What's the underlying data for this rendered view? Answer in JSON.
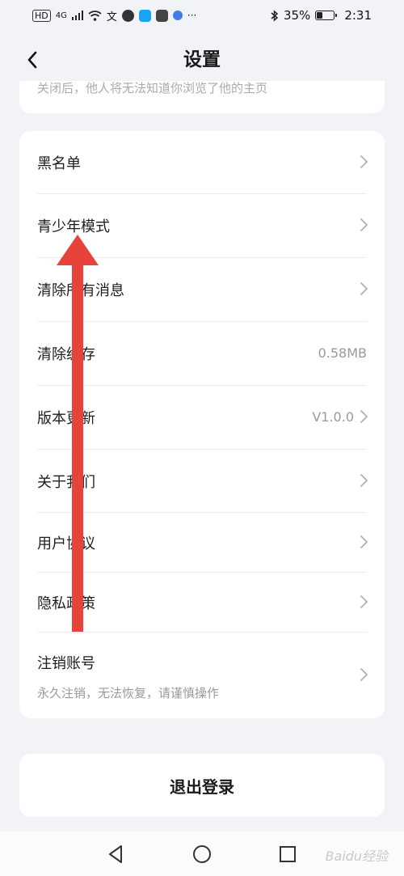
{
  "status_bar": {
    "network_chip": "HD",
    "network_type": "4G",
    "battery_percent": "35%",
    "battery_level": 0.35,
    "time": "2:31",
    "extra": "···"
  },
  "header": {
    "title": "设置"
  },
  "top_card": {
    "hint": "关闭后，他人将无法知道你浏览了他的主页"
  },
  "settings": {
    "items": [
      {
        "label": "黑名单",
        "value": ""
      },
      {
        "label": "青少年模式",
        "value": ""
      },
      {
        "label": "清除所有消息",
        "value": ""
      },
      {
        "label": "清除缓存",
        "value": "0.58MB"
      },
      {
        "label": "版本更新",
        "value": "V1.0.0"
      },
      {
        "label": "关于我们",
        "value": ""
      },
      {
        "label": "用户协议",
        "value": ""
      },
      {
        "label": "隐私政策",
        "value": ""
      },
      {
        "label": "注销账号",
        "value": "",
        "sub": "永久注销，无法恢复，请谨慎操作"
      }
    ]
  },
  "logout": {
    "label": "退出登录"
  },
  "watermark": "Baidu经验",
  "colors": {
    "background": "#f2f3f7",
    "card": "#ffffff",
    "annotation_arrow": "#e8433a"
  }
}
